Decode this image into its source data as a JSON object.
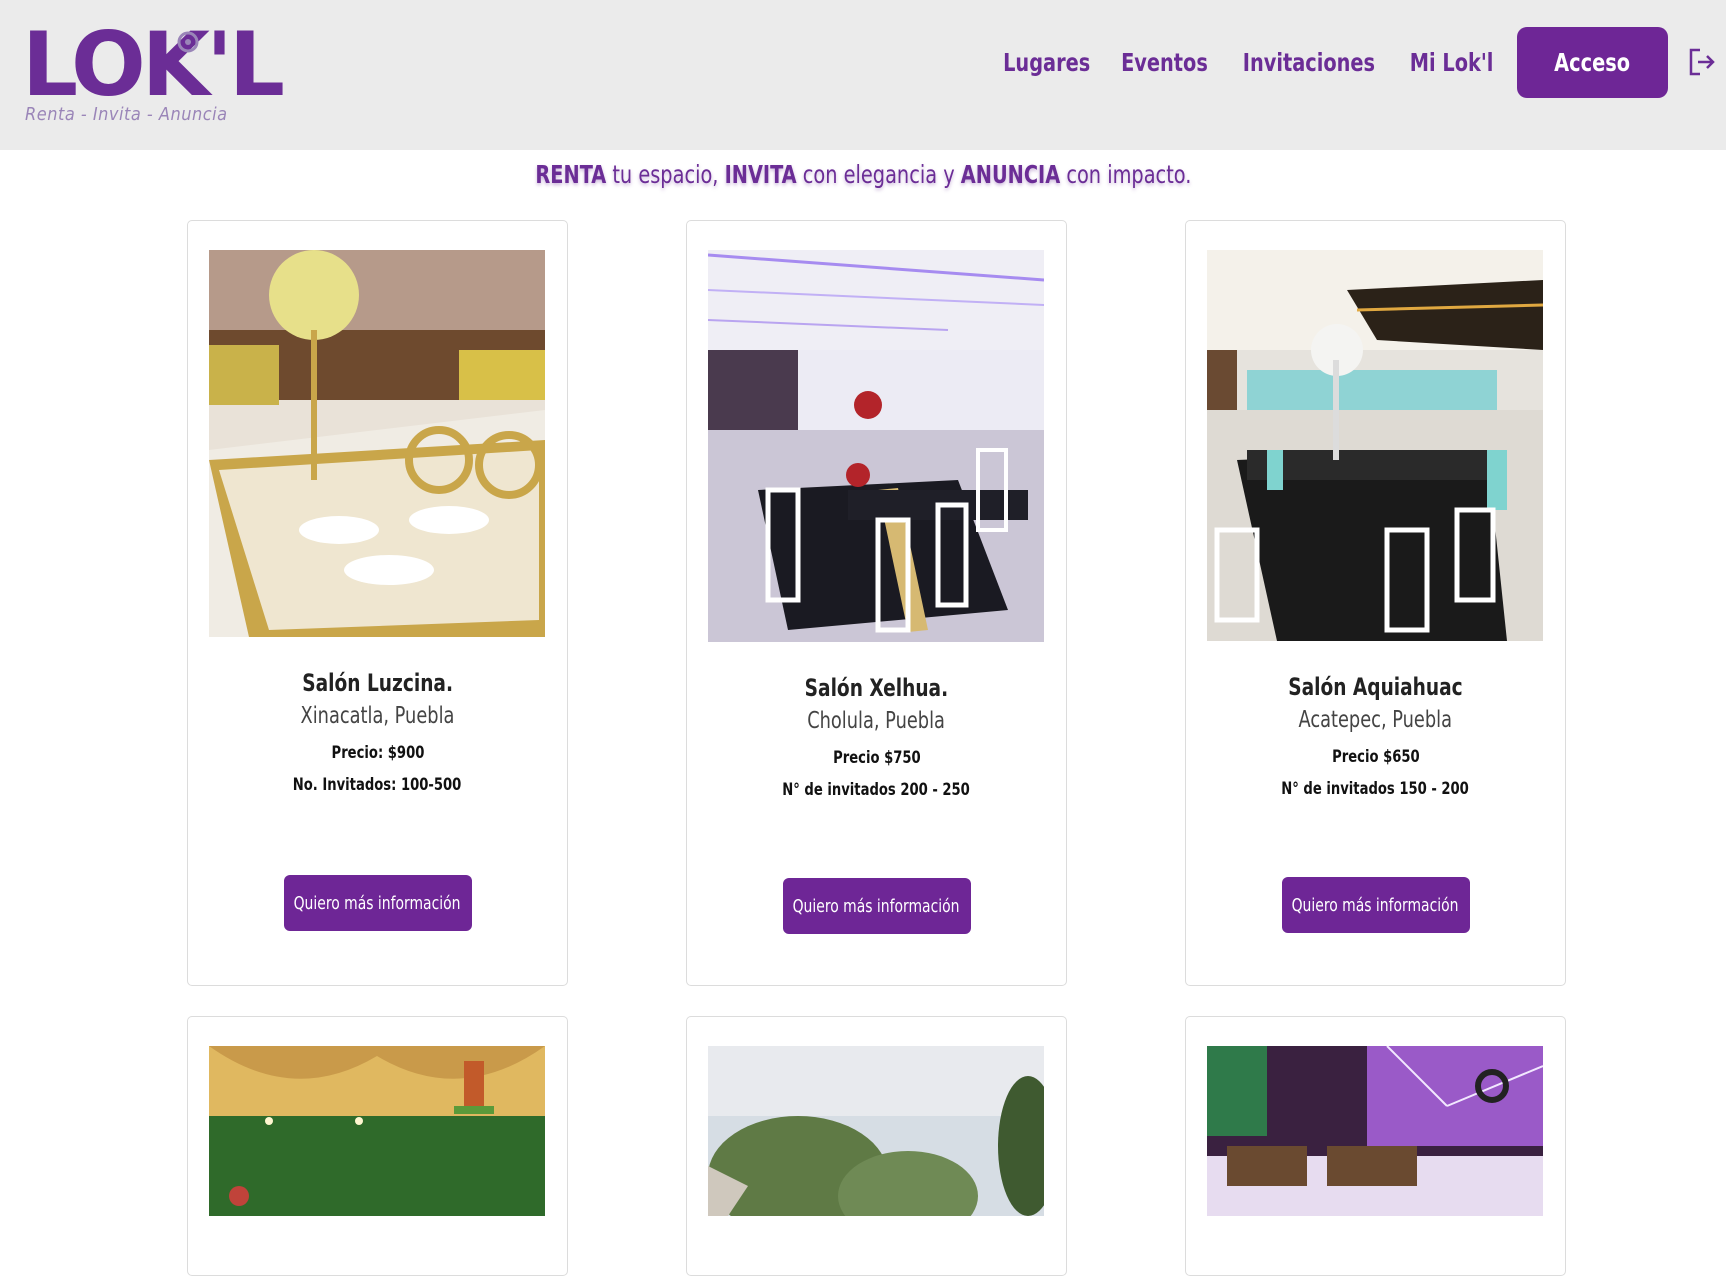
{
  "brand": {
    "logo_text": "LOK'L",
    "tagline": "Renta - Invita - Anuncia",
    "primary_color": "#6e2696",
    "accent_color": "#9a85b8"
  },
  "nav": {
    "items": [
      {
        "label": "Lugares"
      },
      {
        "label": "Eventos"
      },
      {
        "label": "Invitaciones"
      },
      {
        "label": "Mi Lok'l"
      }
    ],
    "acceso_label": "Acceso",
    "logout_icon": "logout-icon"
  },
  "hero": {
    "w1": "RENTA",
    "t1": " tu espacio, ",
    "w2": "INVITA",
    "t2": " con elegancia y ",
    "w3": "ANUNCIA",
    "t3": " con impacto."
  },
  "cards": [
    {
      "title": "Salón Luzcina.",
      "location": "Xinacatla, Puebla",
      "price": "Precio: $900",
      "guests": "No. Invitados: 100-500",
      "button": "Quiero más información"
    },
    {
      "title": "Salón Xelhua.",
      "location": "Cholula, Puebla",
      "price": "Precio $750",
      "guests": "N° de invitados 200 - 250",
      "button": "Quiero más información"
    },
    {
      "title": "Salón Aquiahuac",
      "location": "Acatepec, Puebla",
      "price": "Precio $650",
      "guests": "N° de invitados 150 - 200",
      "button": "Quiero más información"
    }
  ]
}
